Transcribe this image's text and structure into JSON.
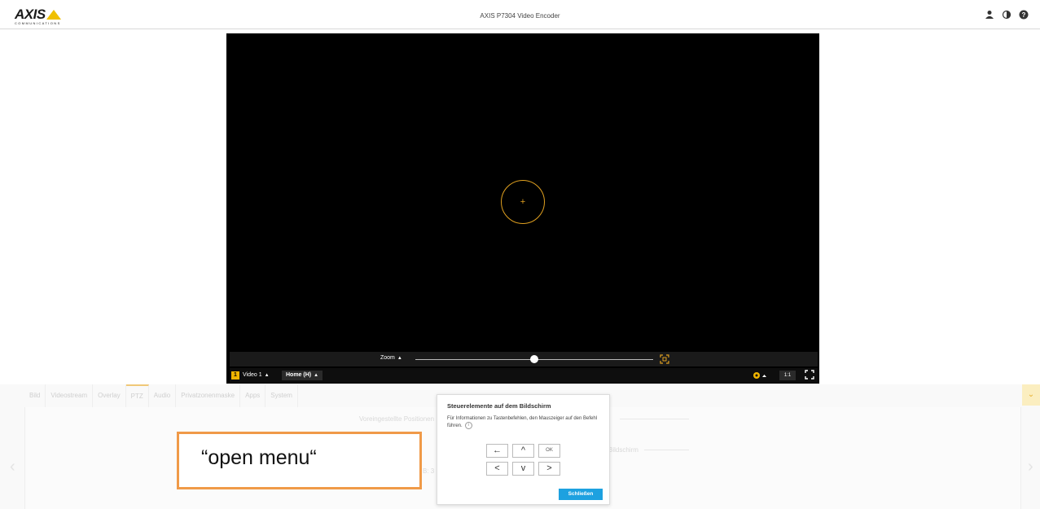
{
  "header": {
    "logo_text": "AXIS",
    "logo_sub": "COMMUNICATIONS",
    "title": "AXIS P7304 Video Encoder",
    "icons": [
      "user-icon",
      "contrast-icon",
      "help-icon"
    ]
  },
  "video": {
    "zoom_label": "Zoom",
    "zoom_level": 0.5,
    "channel_number": "1",
    "channel_label": "Video 1",
    "preset_label": "Home (H)",
    "ratio_label": "1:1",
    "accent_color": "#f0b400"
  },
  "tabs": [
    "Bild",
    "Videostream",
    "Overlay",
    "PTZ",
    "Audio",
    "Privatzonenmaske",
    "Apps",
    "System"
  ],
  "active_tab": "PTZ",
  "background_text": {
    "presets_heading": "Voreingestellte Positionen",
    "onscreen_heading": "Bildschirm",
    "partial_text": "B: 3"
  },
  "popup": {
    "title": "Steuerelemente auf dem Bildschirm",
    "description": "Für Informationen zu Tastenbefehlen, den Mauszeiger auf den Befehl führen.",
    "key_back": "←",
    "key_up": "^",
    "key_ok": "OK",
    "key_left": "<",
    "key_down": "v",
    "key_right": ">",
    "close_label": "Schließen",
    "close_color": "#1da1e0"
  },
  "annotation": {
    "text": "“open menu“",
    "border_color": "#f09a48"
  }
}
